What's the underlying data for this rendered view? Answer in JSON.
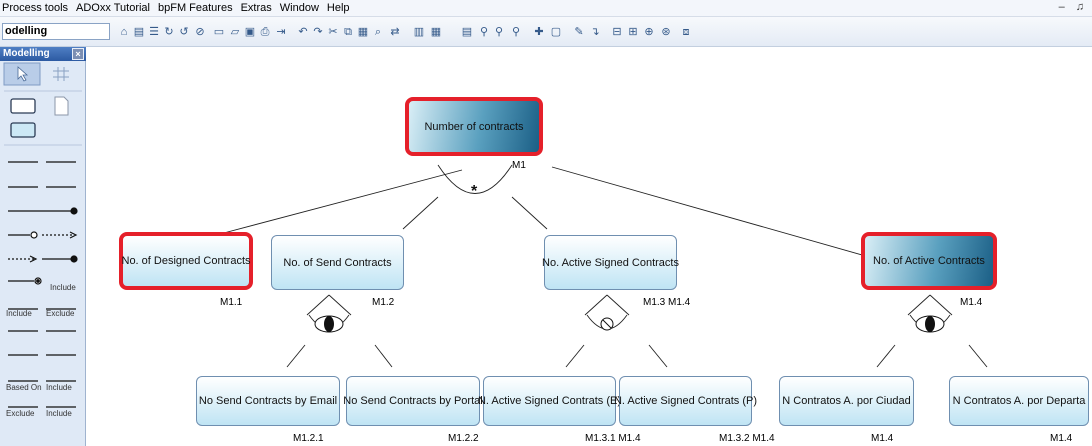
{
  "title_fragment": {
    "left": "g",
    "mid": "",
    "right": "g"
  },
  "menu": {
    "items": [
      "Process tools",
      "ADOxx Tutorial",
      "bpFM Features",
      "Extras",
      "Window",
      "Help"
    ],
    "window_controls": "– ♫"
  },
  "toolbar": {
    "mode": "odelling",
    "buttons": [
      "home-icon",
      "book-icon",
      "tree-icon",
      "refresh-icon",
      "refresh-alt-icon",
      "stop-icon",
      "new-icon",
      "open-icon",
      "save-icon",
      "print-icon",
      "export-icon",
      "undo-icon",
      "redo-icon",
      "cut-icon",
      "copy-icon",
      "paste-icon",
      "find-icon",
      "replace-icon",
      "chart-icon",
      "grid-icon",
      "table-icon",
      "zoom-icon",
      "zoom-fit-icon",
      "zoom-page-icon",
      "cross-icon",
      "window-icon",
      "pen-icon",
      "connector-icon",
      "align-icon",
      "distribute-icon",
      "center-icon",
      "target-icon",
      "layout-icon"
    ]
  },
  "palette": {
    "title": "Modelling",
    "close_label": "×",
    "labels": {
      "include1": "Include",
      "include_left": "Include",
      "exclude_right": "Exclude",
      "based_on": "Based On",
      "include2": "Include",
      "exclude_left": "Exclude",
      "include3": "Include"
    }
  },
  "diagram": {
    "root": {
      "label": "Number of contracts",
      "code": "M1",
      "operator": "*"
    },
    "level1": [
      {
        "label": "No. of Designed Contracts",
        "code": "M1.1"
      },
      {
        "label": "No. of Send Contracts",
        "code": "M1.2"
      },
      {
        "label": "No. Active Signed Contracts",
        "code": "M1.3  M1.4"
      },
      {
        "label": "No. of Active Contracts",
        "code": "M1.4"
      }
    ],
    "level2": [
      {
        "label": "No Send Contracts by Email",
        "code": "M1.2.1"
      },
      {
        "label": "No Send Contracts by Portal",
        "code": "M1.2.2"
      },
      {
        "label": "N. Active Signed Contrats (E)",
        "code": "M1.3.1 M1.4"
      },
      {
        "label": "N. Active Signed Contrats (P)",
        "code": "M1.3.2 M1.4"
      },
      {
        "label": "N Contratos A. por Ciudad",
        "code": "M1.4"
      },
      {
        "label": "N Contratos A. por Departa",
        "code": "M1.4"
      }
    ],
    "colors": {
      "highlight": "#e5202a",
      "node_fill": "#bfe4f4",
      "node_dark": "#1b5f86"
    }
  }
}
